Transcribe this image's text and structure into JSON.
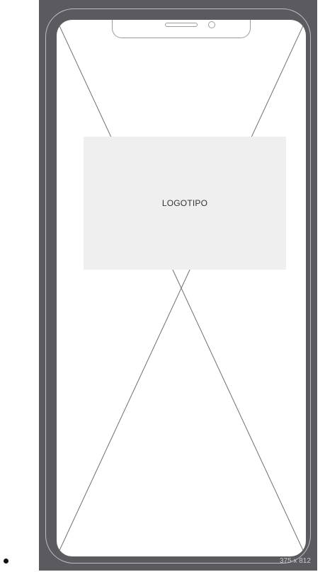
{
  "logo_placeholder": {
    "label": "LOGOTIPO"
  },
  "frame": {
    "dimensions_label": "375 x 812"
  },
  "colors": {
    "frame_bg": "#5b5b5f",
    "screen_bg": "#ffffff",
    "placeholder_bg": "#efefef",
    "line": "#6e6e6e"
  }
}
